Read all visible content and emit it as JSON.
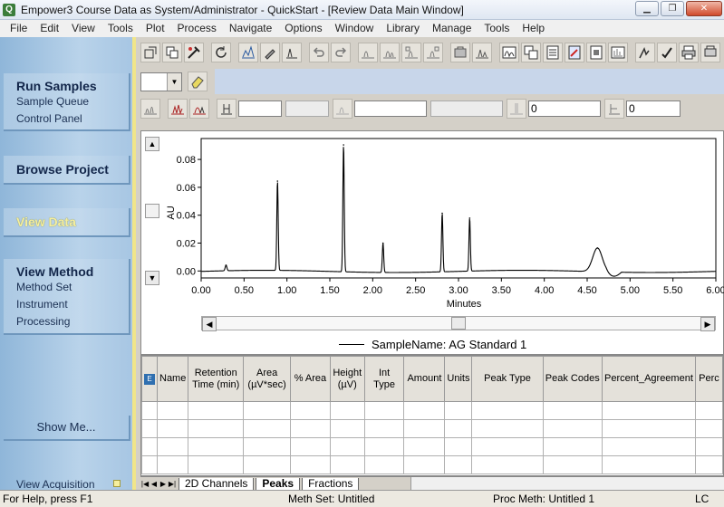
{
  "window": {
    "title": "Empower3 Course Data as System/Administrator - QuickStart - [Review Data Main Window]",
    "app_icon": "Q"
  },
  "menu": [
    "File",
    "Edit",
    "View",
    "Tools",
    "Plot",
    "Process",
    "Navigate",
    "Options",
    "Window",
    "Library",
    "Manage",
    "Tools",
    "Help"
  ],
  "sidebar": {
    "run_samples": {
      "title": "Run Samples",
      "items": [
        "Sample Queue",
        "Control Panel"
      ]
    },
    "browse_project": {
      "title": "Browse Project"
    },
    "view_data": {
      "title": "View Data"
    },
    "view_method": {
      "title": "View Method",
      "items": [
        "Method Set",
        "Instrument",
        "Processing"
      ]
    },
    "show_me": "Show Me...",
    "view_acquisition": "View Acquisition"
  },
  "toolbar": {
    "field_a": "0",
    "field_b": "0"
  },
  "chart_data": {
    "type": "line",
    "xlabel": "Minutes",
    "ylabel": "AU",
    "xlim": [
      0.0,
      6.0
    ],
    "ylim": [
      -0.005,
      0.095
    ],
    "x_ticks": [
      "0.00",
      "0.50",
      "1.00",
      "1.50",
      "2.00",
      "2.50",
      "3.00",
      "3.50",
      "4.00",
      "4.50",
      "5.00",
      "5.50",
      "6.00"
    ],
    "y_ticks": [
      "0.00",
      "0.02",
      "0.04",
      "0.06",
      "0.08"
    ],
    "series": [
      {
        "name": "SampleName: AG Standard 1",
        "peaks": [
          {
            "rt": 0.29,
            "height": 0.004
          },
          {
            "rt": 0.89,
            "height": 0.064
          },
          {
            "rt": 1.66,
            "height": 0.091
          },
          {
            "rt": 2.12,
            "height": 0.021
          },
          {
            "rt": 2.81,
            "height": 0.042
          },
          {
            "rt": 3.13,
            "height": 0.038
          },
          {
            "rt": 4.62,
            "height": 0.017
          }
        ]
      }
    ]
  },
  "table": {
    "columns": [
      "",
      "Name",
      "Retention Time (min)",
      "Area (µV*sec)",
      "% Area",
      "Height (µV)",
      "Int Type",
      "Amount",
      "Units",
      "Peak Type",
      "Peak Codes",
      "Percent_Agreement",
      "Perc"
    ],
    "empty_rows": 4
  },
  "tabs": [
    "2D Channels",
    "Peaks",
    "Fractions"
  ],
  "status": {
    "help": "For Help, press F1",
    "meth_set": "Meth Set: Untitled",
    "proc_meth": "Proc Meth: Untitled 1",
    "mode": "LC"
  }
}
